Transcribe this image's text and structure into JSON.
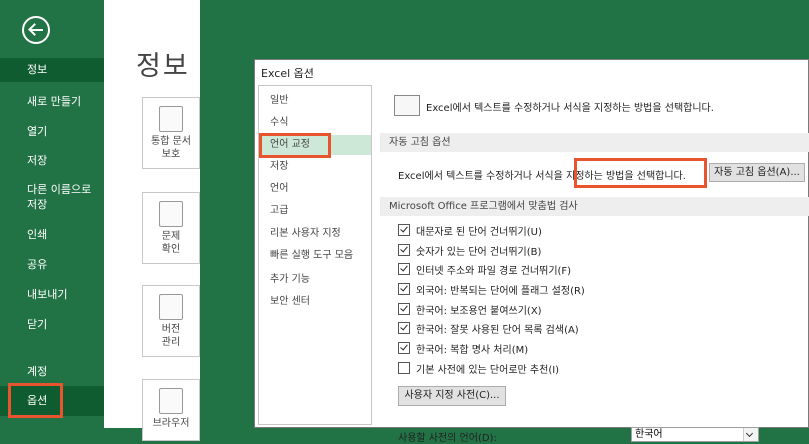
{
  "backstage": {
    "nav": [
      "정보",
      "새로 만들기",
      "열기",
      "저장",
      "다른 이름으로 저장",
      "인쇄",
      "공유",
      "내보내기",
      "닫기",
      "계정",
      "옵션"
    ],
    "page_title": "정보",
    "tiles": [
      {
        "label": "통합 문서\n보호",
        "icon": "lock-icon"
      },
      {
        "label": "문제\n확인",
        "icon": "inspect-icon"
      },
      {
        "label": "버전\n관리",
        "icon": "versions-icon"
      },
      {
        "label": "브라우저",
        "icon": "browser-icon"
      }
    ]
  },
  "dialog": {
    "title": "Excel 옵션",
    "categories": [
      "일반",
      "수식",
      "언어 교정",
      "저장",
      "언어",
      "고급",
      "리본 사용자 지정",
      "빠른 실행 도구 모음",
      "추가 기능",
      "보안 센터"
    ],
    "selected_category": "언어 교정",
    "header_text": "Excel에서 텍스트를 수정하거나 서식을 지정하는 방법을 선택합니다.",
    "autocorrect": {
      "section_title": "자동 고침 옵션",
      "description": "Excel에서 텍스트를 수정하거나 서식을 지정하는 방법을 선택합니다.",
      "button_label": "자동 고침 옵션(A)..."
    },
    "spelling": {
      "section_title": "Microsoft Office 프로그램에서 맞춤법 검사",
      "options": [
        {
          "label": "대문자로 된 단어 건너뛰기(U)",
          "checked": true
        },
        {
          "label": "숫자가 있는 단어 건너뛰기(B)",
          "checked": true
        },
        {
          "label": "인터넷 주소와 파일 경로 건너뛰기(F)",
          "checked": true
        },
        {
          "label": "외국어: 반복되는 단어에 플래그 설정(R)",
          "checked": true
        },
        {
          "label": "한국어: 보조용언 붙여쓰기(X)",
          "checked": true
        },
        {
          "label": "한국어: 잘못 사용된 단어 목록 검색(A)",
          "checked": true
        },
        {
          "label": "한국어: 복합 명사 처리(M)",
          "checked": true
        },
        {
          "label": "기본 사전에 있는 단어로만 추천(I)",
          "checked": false
        }
      ],
      "custom_dict_button": "사용자 지정 사전(C)...",
      "dict_language_label": "사용할 사전의 언어(D):",
      "dict_language_value": "한국어"
    }
  },
  "colors": {
    "excel_green": "#217346",
    "highlight": "#e8542d"
  }
}
